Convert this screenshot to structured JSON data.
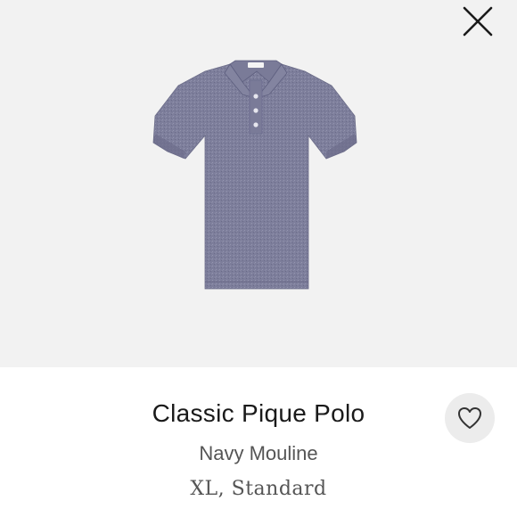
{
  "product": {
    "name": "Classic Pique Polo",
    "color": "Navy Mouline",
    "size": "XL, Standard"
  },
  "icons": {
    "close": "close-icon",
    "favorite": "heart-outline-icon"
  },
  "colors": {
    "image_background": "#f2f2f2",
    "shirt": "#7b7c9a",
    "title_text": "#1a1a1a",
    "secondary_text": "#555555",
    "favorite_button_bg": "#ececec"
  }
}
